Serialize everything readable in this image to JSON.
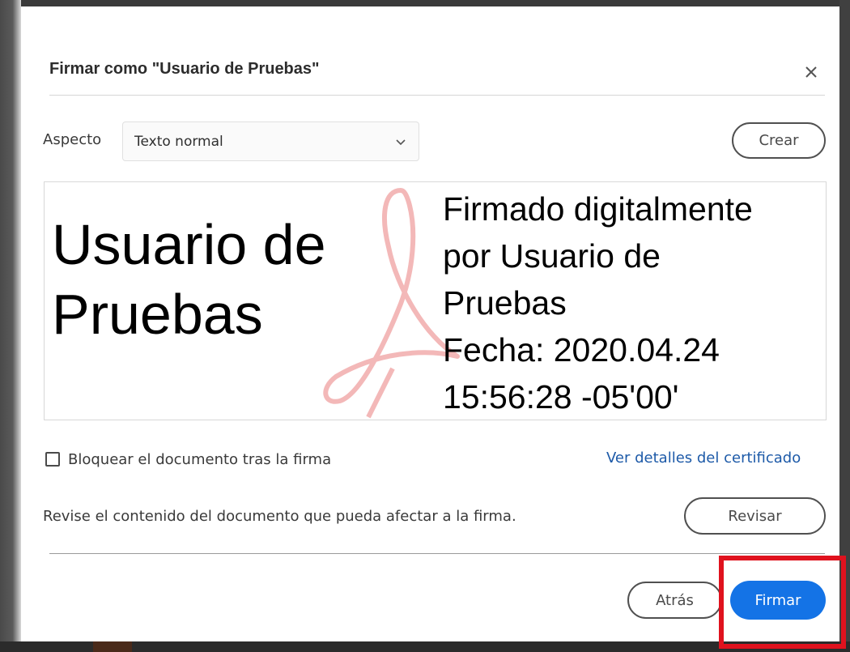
{
  "dialog": {
    "title": "Firmar como \"Usuario de Pruebas\"",
    "close_icon": "close-icon"
  },
  "appearance": {
    "label": "Aspecto",
    "selected_value": "Texto normal",
    "create_label": "Crear"
  },
  "preview": {
    "name_line1": "Usuario de",
    "name_line2": "Pruebas",
    "detail_lines": [
      "Firmado digitalmente",
      "por Usuario de",
      "Pruebas",
      "Fecha: 2020.04.24",
      "15:56:28 -05'00'"
    ],
    "watermark_icon": "acrobat-logo-icon"
  },
  "options": {
    "lock_label": "Bloquear el documento tras la firma",
    "lock_checked": false,
    "cert_link": "Ver detalles del certificado"
  },
  "review": {
    "text": "Revise el contenido del documento que pueda afectar a la firma.",
    "button_label": "Revisar"
  },
  "footer": {
    "back_label": "Atrás",
    "sign_label": "Firmar"
  },
  "colors": {
    "primary_button": "#1473e6",
    "link": "#1d5aa8",
    "highlight": "#e0121e",
    "watermark": "#f3b8b8"
  }
}
